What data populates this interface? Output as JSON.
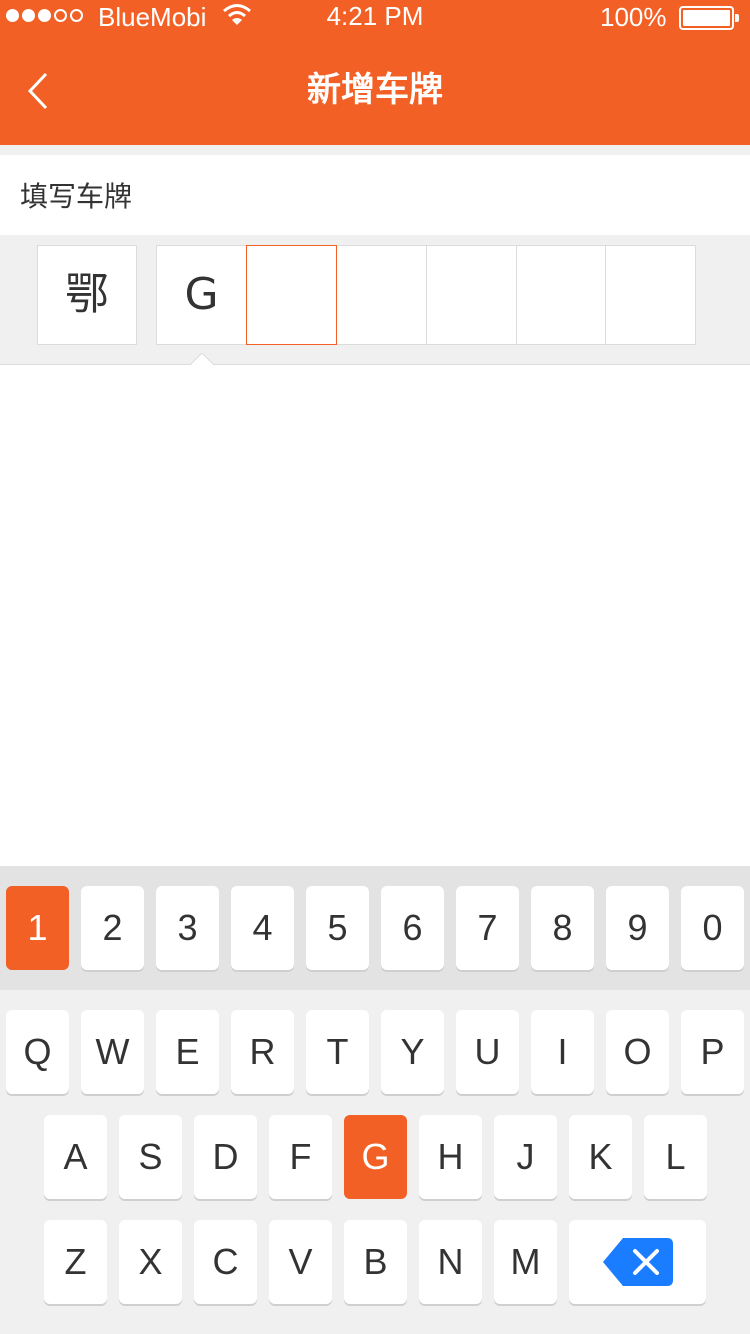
{
  "status_bar": {
    "carrier": "BlueMobi",
    "time": "4:21 PM",
    "battery": "100%",
    "signal_icon": "signal-dots-icon",
    "wifi_icon": "wifi-icon",
    "battery_icon": "battery-icon"
  },
  "nav": {
    "title": "新增车牌",
    "back_icon": "chevron-left-icon"
  },
  "plate": {
    "label": "填写车牌",
    "province": "鄂",
    "chars": [
      "G",
      "",
      "",
      "",
      "",
      ""
    ],
    "active_index": 1
  },
  "keyboard": {
    "numbers": [
      "1",
      "2",
      "3",
      "4",
      "5",
      "6",
      "7",
      "8",
      "9",
      "0"
    ],
    "row1": [
      "Q",
      "W",
      "E",
      "R",
      "T",
      "Y",
      "U",
      "I",
      "O",
      "P"
    ],
    "row2": [
      "A",
      "S",
      "D",
      "F",
      "G",
      "H",
      "J",
      "K",
      "L"
    ],
    "row3": [
      "Z",
      "X",
      "C",
      "V",
      "B",
      "N",
      "M"
    ],
    "highlighted_keys": [
      "1",
      "G"
    ],
    "delete_icon": "backspace-icon"
  },
  "colors": {
    "accent": "#f26025",
    "delete_key": "#1a7cff",
    "background": "#f0f0f0"
  }
}
